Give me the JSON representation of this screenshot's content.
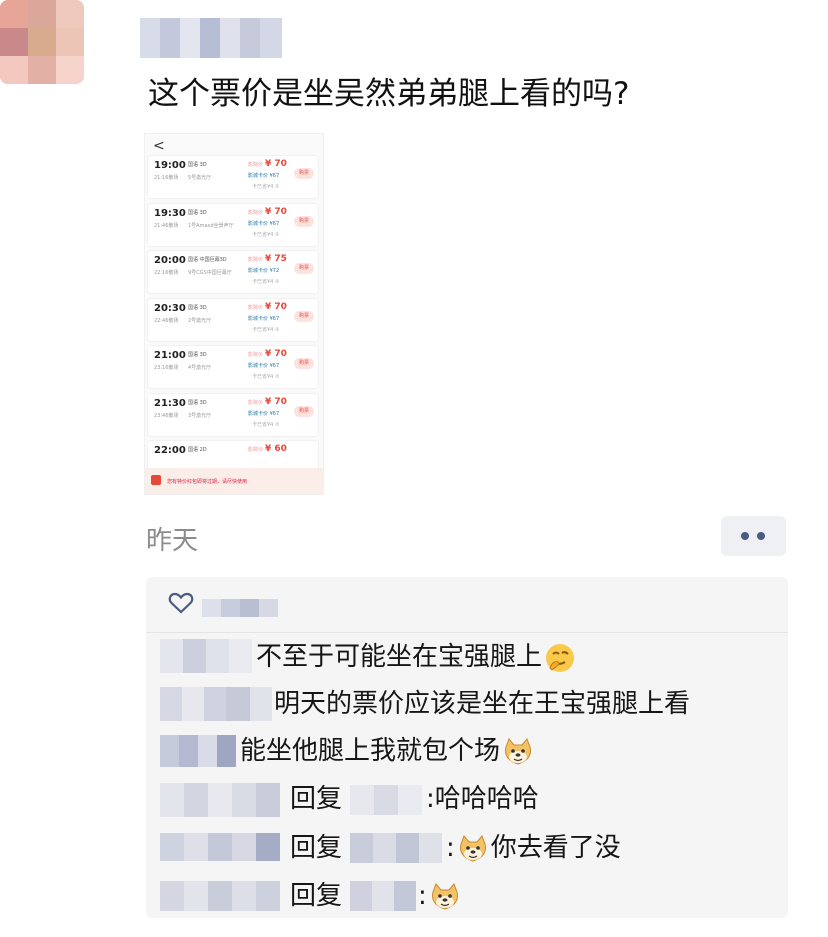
{
  "post": {
    "text": "这个票价是坐吴然弟弟腿上看的吗?",
    "timestamp": "昨天"
  },
  "showtimes_screenshot": {
    "back": "<",
    "rows": [
      {
        "time": "19:00",
        "end": "21:16散场",
        "lang": "国语 3D",
        "hall": "5号激光厅",
        "orig": "影院价",
        "price": "¥ 70",
        "disc": "影城卡价 ¥67",
        "card": "卡已省¥4 ②",
        "buy": "购票"
      },
      {
        "time": "19:30",
        "end": "21:46散场",
        "lang": "国语 3D",
        "hall": "1号Amaxd全景声厅",
        "orig": "影院价",
        "price": "¥ 70",
        "disc": "影城卡价 ¥67",
        "card": "卡已省¥4 ②",
        "buy": "购票"
      },
      {
        "time": "20:00",
        "end": "22:16散场",
        "lang": "国语 中国巨幕3D",
        "hall": "9号CGS中国巨幕厅",
        "orig": "影院价",
        "price": "¥ 75",
        "disc": "影城卡价 ¥72",
        "card": "卡已省¥4 ②",
        "buy": "购票"
      },
      {
        "time": "20:30",
        "end": "22:46散场",
        "lang": "国语 3D",
        "hall": "2号激光厅",
        "orig": "影院价",
        "price": "¥ 70",
        "disc": "影城卡价 ¥67",
        "card": "卡已省¥4 ②",
        "buy": "购票"
      },
      {
        "time": "21:00",
        "end": "23:16散场",
        "lang": "国语 3D",
        "hall": "4号激光厅",
        "orig": "影院价",
        "price": "¥ 70",
        "disc": "影城卡价 ¥67",
        "card": "卡已省¥4 ②",
        "buy": "购票"
      },
      {
        "time": "21:30",
        "end": "23:46散场",
        "lang": "国语 3D",
        "hall": "3号激光厅",
        "orig": "影院价",
        "price": "¥ 70",
        "disc": "影城卡价 ¥67",
        "card": "卡已省¥4 ②",
        "buy": "购票"
      },
      {
        "time": "22:00",
        "end": "",
        "lang": "国语 2D",
        "hall": "",
        "orig": "影院价",
        "price": "¥ 60",
        "disc": "",
        "card": "",
        "buy": ""
      }
    ],
    "notice": "您有特价红包即将过期，请尽快使用"
  },
  "comments": [
    {
      "text": "不至于可能坐在宝强腿上",
      "emoji": "thinking-face"
    },
    {
      "text": "明天的票价应该是坐在王宝强腿上看",
      "emoji": ""
    },
    {
      "text": "能坐他腿上我就包个场",
      "emoji": "doge"
    },
    {
      "reply_label": "回复",
      "colon": ":",
      "text": "哈哈哈哈",
      "emoji": ""
    },
    {
      "reply_label": "回复",
      "colon": ":",
      "text": "你去看了没",
      "emoji": "doge"
    },
    {
      "reply_label": "回复",
      "colon": ":",
      "text": "",
      "emoji": "doge"
    }
  ],
  "icons": {
    "like": "heart-outline-icon",
    "more": "more-dots-icon"
  },
  "colors": {
    "accent": "#4a5a80",
    "price_red": "#e5493a",
    "timestamp_gray": "#8c8c8c"
  }
}
